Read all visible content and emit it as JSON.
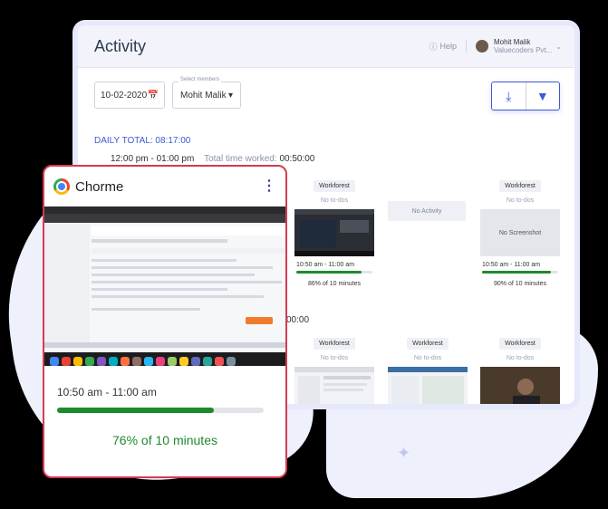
{
  "header": {
    "title": "Activity",
    "help": "Help",
    "user_name": "Mohit Malik",
    "user_org": "Valuecoders Pvt..."
  },
  "controls": {
    "date": "10-02-2020",
    "members_label": "Select members",
    "member": "Mohit Malik"
  },
  "summary": {
    "daily_total": "DAILY TOTAL: 08:17:00",
    "time_range": "12:00 pm - 01:00 pm",
    "total_label": "Total time worked:",
    "total_value": "00:50:00",
    "second_row_time": "00:00"
  },
  "row1": [
    {
      "project": "Workforest",
      "todo": "No to-dos",
      "slot": "10:50 am - 11:00 am",
      "progress": 0.86,
      "pct": "86% of 10 minutes"
    },
    {
      "no_activity": "No Activity"
    },
    {
      "project": "Workforest",
      "todo": "No to-dos",
      "no_screenshot": "No Screenshot",
      "slot": "10:50 am - 11:00 am",
      "progress": 0.9,
      "pct": "90% of 10 minutes"
    }
  ],
  "row2": [
    {
      "project": "Workforest",
      "todo": "No to-dos"
    },
    {
      "project": "Workforest",
      "todo": "No to-dos"
    },
    {
      "project": "Workforest",
      "todo": "No to-dos"
    }
  ],
  "card": {
    "title": "Chorme",
    "slot": "10:50 am - 11:00 am",
    "progress": 0.76,
    "pct": "76% of 10 minutes"
  },
  "colors": {
    "accent": "#3d5ad6",
    "success": "#1e8a2e",
    "card_border": "#d63a52"
  }
}
